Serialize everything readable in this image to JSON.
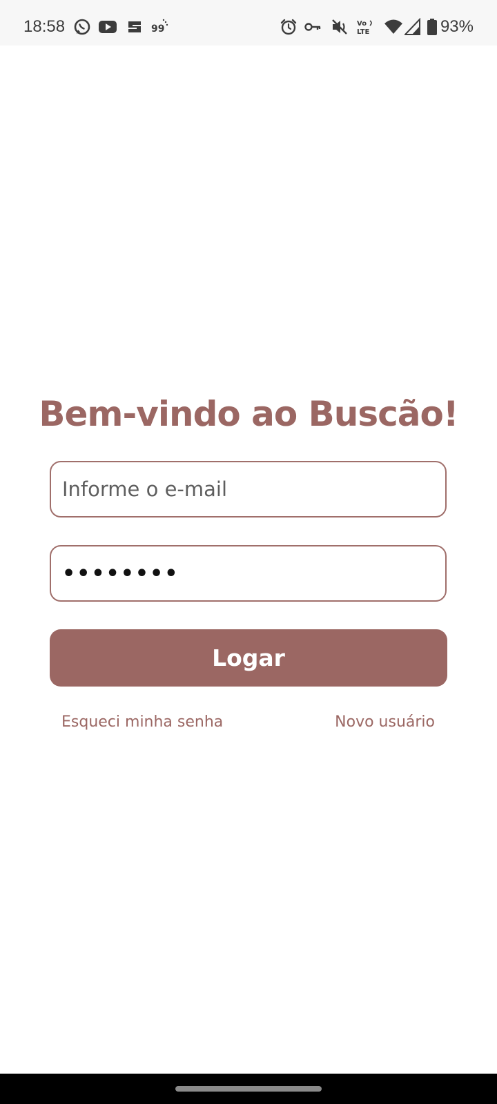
{
  "status_bar": {
    "time": "18:58",
    "left_icons": [
      "whatsapp-icon",
      "youtube-icon",
      "app-s-icon",
      "app-99-icon"
    ],
    "right_icons": [
      "alarm-icon",
      "vpn-key-icon",
      "vibrate-off-icon",
      "volte-icon",
      "wifi-icon",
      "signal-icon",
      "battery-icon"
    ],
    "volte_label": "Vo LTE",
    "battery_percent": "93%"
  },
  "login": {
    "title": "Bem-vindo ao Buscão!",
    "email_placeholder": "Informe o e-mail",
    "email_value": "",
    "password_value": "••••••••",
    "login_button": "Logar",
    "forgot_password": "Esqueci minha senha",
    "new_user": "Novo usuário"
  },
  "colors": {
    "accent": "#9b6763",
    "border": "#a06f6b",
    "status_bar_bg": "#f7f7f7",
    "nav_bar_bg": "#000000"
  }
}
